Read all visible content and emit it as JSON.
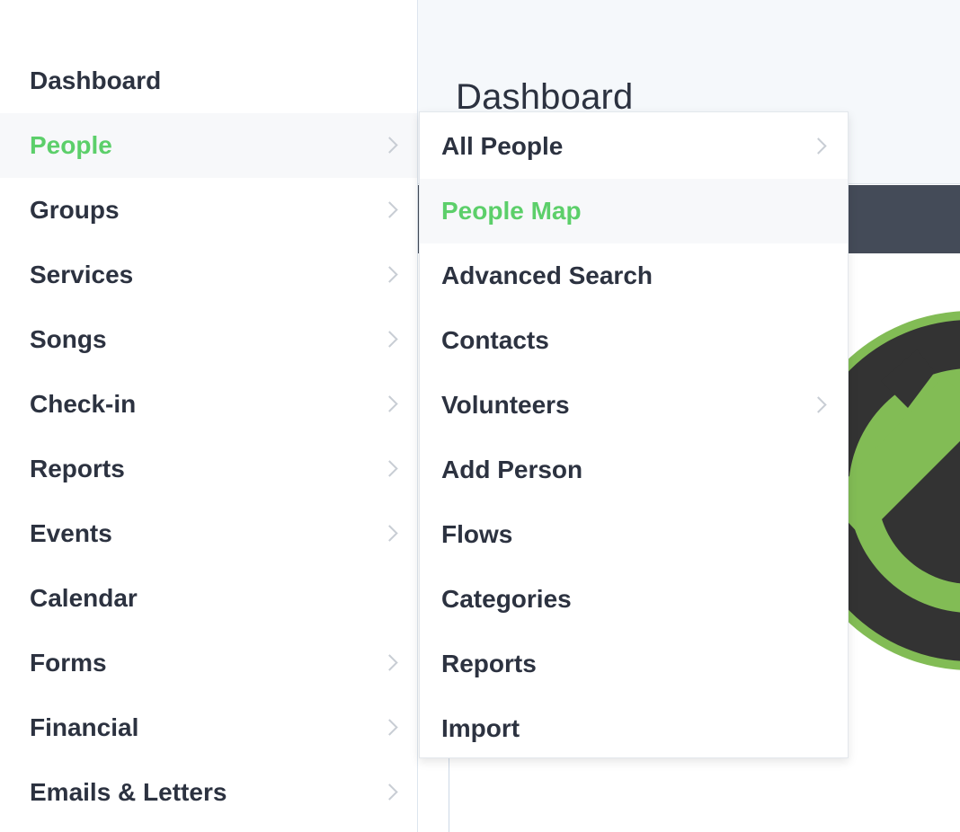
{
  "main": {
    "title": "Dashboard"
  },
  "sidebar": {
    "items": [
      {
        "label": "Dashboard",
        "has_submenu": false,
        "active": false
      },
      {
        "label": "People",
        "has_submenu": true,
        "active": true
      },
      {
        "label": "Groups",
        "has_submenu": true,
        "active": false
      },
      {
        "label": "Services",
        "has_submenu": true,
        "active": false
      },
      {
        "label": "Songs",
        "has_submenu": true,
        "active": false
      },
      {
        "label": "Check-in",
        "has_submenu": true,
        "active": false
      },
      {
        "label": "Reports",
        "has_submenu": true,
        "active": false
      },
      {
        "label": "Events",
        "has_submenu": true,
        "active": false
      },
      {
        "label": "Calendar",
        "has_submenu": false,
        "active": false
      },
      {
        "label": "Forms",
        "has_submenu": true,
        "active": false
      },
      {
        "label": "Financial",
        "has_submenu": true,
        "active": false
      },
      {
        "label": "Emails & Letters",
        "has_submenu": true,
        "active": false
      }
    ]
  },
  "submenu": {
    "items": [
      {
        "label": "All People",
        "has_submenu": true,
        "active": false
      },
      {
        "label": "People Map",
        "has_submenu": false,
        "active": true
      },
      {
        "label": "Advanced Search",
        "has_submenu": false,
        "active": false
      },
      {
        "label": "Contacts",
        "has_submenu": false,
        "active": false
      },
      {
        "label": "Volunteers",
        "has_submenu": true,
        "active": false
      },
      {
        "label": "Add Person",
        "has_submenu": false,
        "active": false
      },
      {
        "label": "Flows",
        "has_submenu": false,
        "active": false
      },
      {
        "label": "Categories",
        "has_submenu": false,
        "active": false
      },
      {
        "label": "Reports",
        "has_submenu": false,
        "active": false
      },
      {
        "label": "Import",
        "has_submenu": false,
        "active": false
      }
    ]
  },
  "icons": {
    "submenu_indicator": "chevron-right-icon",
    "brand_logo": "brand-logo-icon"
  },
  "colors": {
    "accent_green": "#5ccf6a",
    "text": "#2c3240",
    "dark_bar": "#444b58",
    "logo_green": "#82bc55",
    "logo_dark": "#333333"
  }
}
